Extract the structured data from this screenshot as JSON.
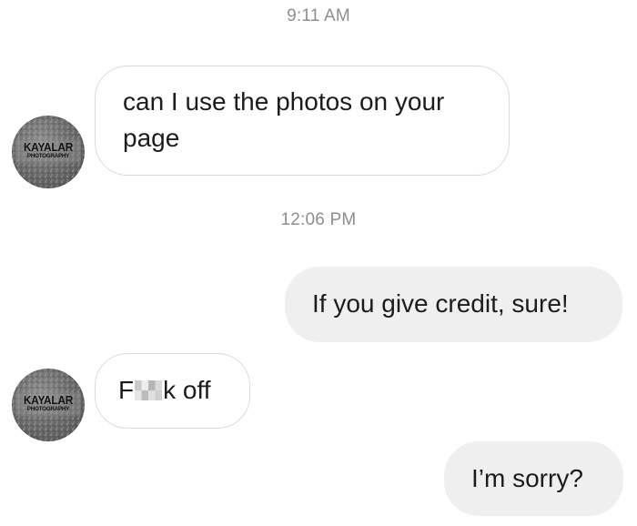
{
  "thread": {
    "timestamps": [
      "9:11 AM",
      "12:06 PM"
    ],
    "contact": {
      "avatar_icon": "kayalar-photography-logo-icon",
      "avatar_logo_top": "KAYALAR",
      "avatar_logo_bottom": "PHOTOGRAPHY"
    },
    "messages": [
      {
        "direction": "incoming",
        "text": "can I use the photos on your page"
      },
      {
        "direction": "outgoing",
        "text": "If you give credit, sure!"
      },
      {
        "direction": "incoming",
        "text_start": "F",
        "text_censored": "**",
        "text_end": "k off"
      },
      {
        "direction": "outgoing",
        "text": "I’m sorry?"
      }
    ]
  },
  "colors": {
    "outgoing_bubble": "#efefef",
    "incoming_border": "#dbdbdb",
    "timestamp": "#8e8e8e",
    "text": "#1c1c1c"
  }
}
